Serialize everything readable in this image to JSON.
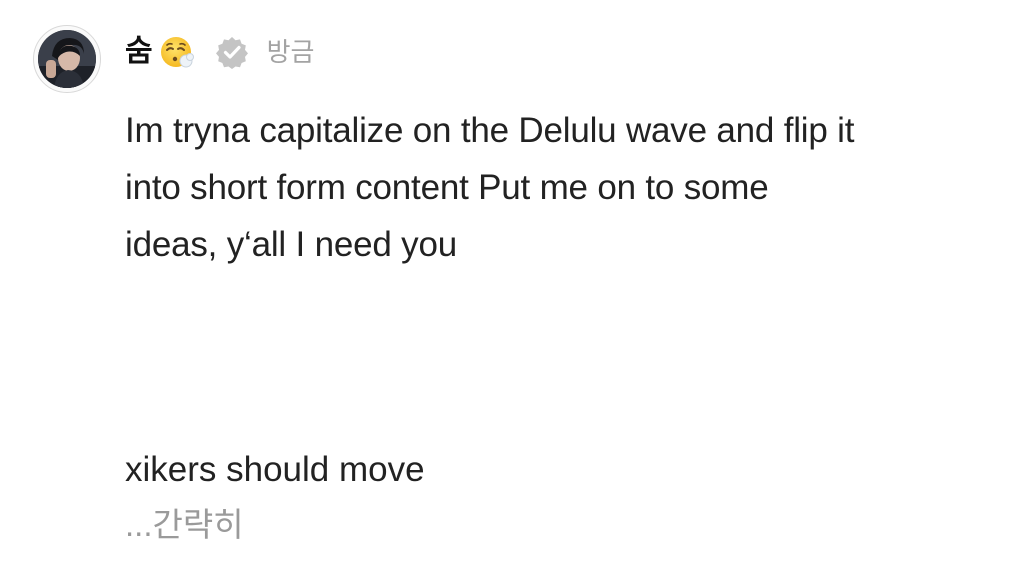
{
  "post": {
    "username": "숨",
    "emoji_icon": "exhaling-face-icon",
    "verified_icon": "verified-badge-icon",
    "timestamp": "방금",
    "body_lines": [
      "Im tryna capitalize on the Delulu wave and flip it",
      "into short form content Put me on to some",
      "ideas, y‘all I need you"
    ],
    "extra_line": "xikers should move",
    "more_label": "...간략히"
  },
  "colors": {
    "text": "#222222",
    "timestamp": "#a3a3a3",
    "more": "#9a9a9a",
    "badge": "#c4c4c4"
  }
}
